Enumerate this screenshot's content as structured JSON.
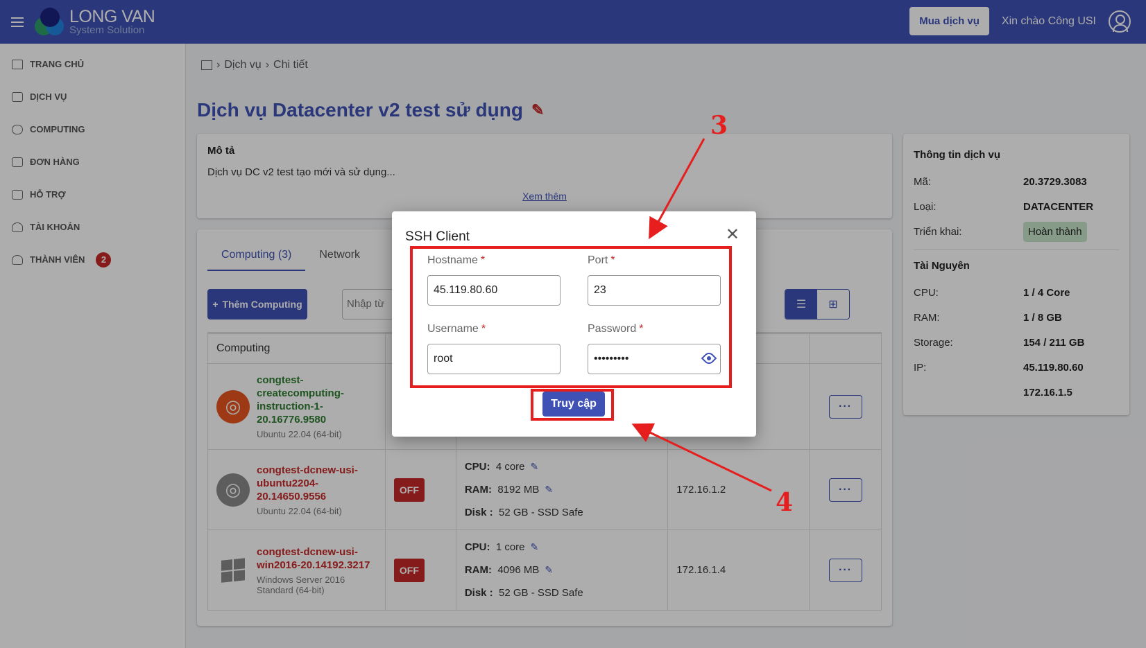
{
  "header": {
    "logo_line1": "LONG VAN",
    "logo_line2": "System Solution",
    "buy_button": "Mua dịch vụ",
    "greeting": "Xin chào Công USI"
  },
  "sidebar": {
    "items": [
      {
        "label": "TRANG CHỦ",
        "icon": "home-icon"
      },
      {
        "label": "DỊCH VỤ",
        "icon": "box-icon"
      },
      {
        "label": "COMPUTING",
        "icon": "cloud-icon"
      },
      {
        "label": "ĐƠN HÀNG",
        "icon": "bag-icon"
      },
      {
        "label": "HỖ TRỢ",
        "icon": "ticket-icon"
      },
      {
        "label": "TÀI KHOẢN",
        "icon": "user-icon"
      },
      {
        "label": "THÀNH VIÊN",
        "icon": "users-icon",
        "badge": "2"
      }
    ]
  },
  "breadcrumb": {
    "items": [
      "Dịch vụ",
      "Chi tiết"
    ]
  },
  "page": {
    "title": "Dịch vụ Datacenter v2 test sử dụng"
  },
  "description": {
    "heading": "Mô tả",
    "text": "Dịch vụ DC v2 test tạo mới và sử dụng...",
    "more": "Xem thêm"
  },
  "service_info": {
    "heading": "Thông tin dịch vụ",
    "code_label": "Mã:",
    "code": "20.3729.3083",
    "type_label": "Loại:",
    "type": "DATACENTER",
    "deploy_label": "Triển khai:",
    "deploy": "Hoàn thành",
    "resources_heading": "Tài Nguyên",
    "cpu_label": "CPU:",
    "cpu": "1 / 4 Core",
    "ram_label": "RAM:",
    "ram": "1 / 8 GB",
    "storage_label": "Storage:",
    "storage": "154 / 211 GB",
    "ip_label": "IP:",
    "ip1": "45.119.80.60",
    "ip2": "172.16.1.5"
  },
  "computing": {
    "tabs": [
      "Computing (3)",
      "Network"
    ],
    "add_button": "Thêm Computing",
    "search_placeholder": "Nhập từ",
    "col_header": "Computing",
    "rows": [
      {
        "name": "congtest-createcomputing-instruction-1-20.16776.9580",
        "os": "Ubuntu 22.04 (64-bit)"
      },
      {
        "name": "congtest-dcnew-usi-ubuntu2204-20.14650.9556",
        "os": "Ubuntu 22.04 (64-bit)",
        "status": "OFF",
        "cpu_label": "CPU:",
        "cpu": "4 core",
        "ram_label": "RAM:",
        "ram": "8192 MB",
        "disk_label": "Disk :",
        "disk": "52 GB - SSD Safe",
        "ip": "172.16.1.2"
      },
      {
        "name": "congtest-dcnew-usi-win2016-20.14192.3217",
        "os": "Windows Server 2016 Standard (64-bit)",
        "status": "OFF",
        "cpu_label": "CPU:",
        "cpu": "1 core",
        "ram_label": "RAM:",
        "ram": "4096 MB",
        "disk_label": "Disk :",
        "disk": "52 GB - SSD Safe",
        "ip": "172.16.1.4"
      }
    ]
  },
  "modal": {
    "title": "SSH Client",
    "hostname_label": "Hostname",
    "hostname": "45.119.80.60",
    "port_label": "Port",
    "port": "23",
    "username_label": "Username",
    "username": "root",
    "password_label": "Password",
    "password": "•••••••••",
    "required": "*",
    "submit": "Truy cập"
  },
  "annotations": {
    "step3": "3",
    "step4": "4"
  },
  "colors": {
    "primary": "#3f51b5",
    "annotation": "#e61e1e",
    "danger": "#c62828",
    "success": "#2e7d32"
  }
}
